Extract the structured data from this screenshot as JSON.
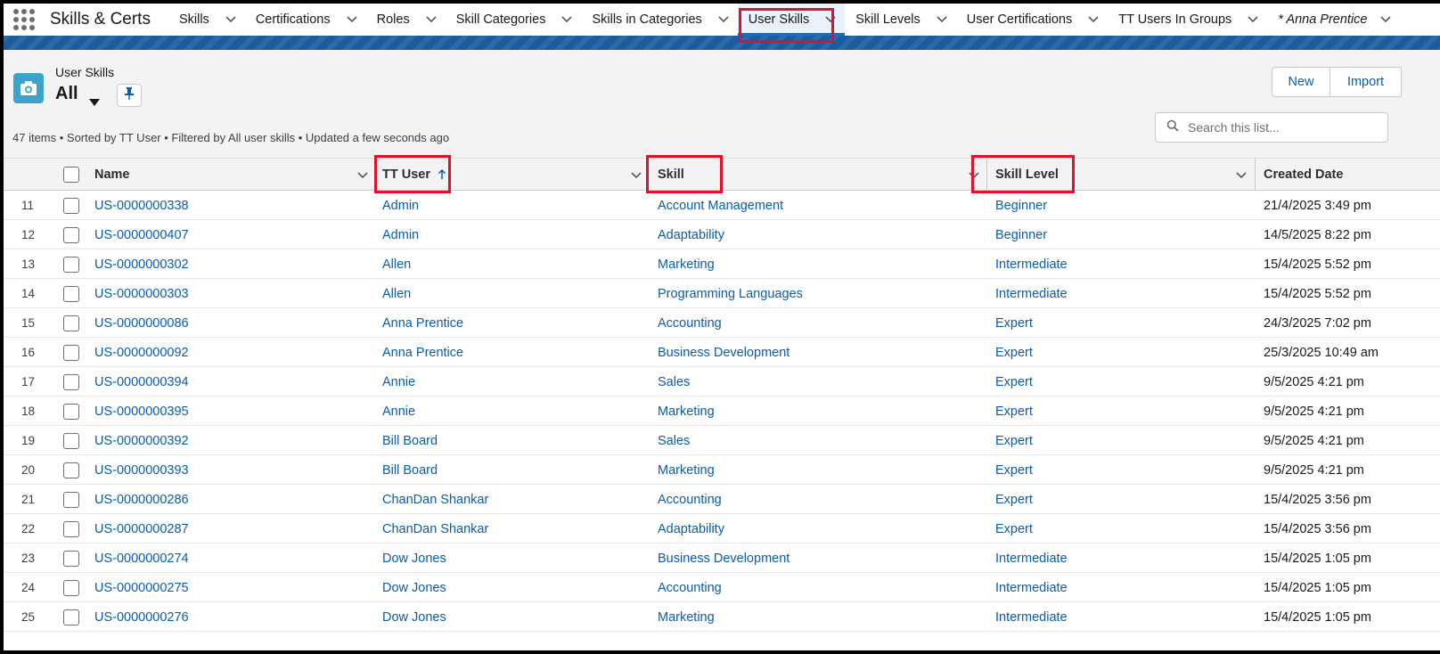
{
  "app": {
    "name": "Skills & Certs"
  },
  "nav": {
    "tabs": [
      {
        "label": "Skills"
      },
      {
        "label": "Certifications"
      },
      {
        "label": "Roles"
      },
      {
        "label": "Skill Categories"
      },
      {
        "label": "Skills in Categories"
      },
      {
        "label": "User Skills",
        "active": true
      },
      {
        "label": "Skill Levels"
      },
      {
        "label": "User Certifications"
      },
      {
        "label": "TT Users In Groups"
      },
      {
        "label": "* Anna Prentice"
      }
    ]
  },
  "list": {
    "object_label": "User Skills",
    "view_name": "All",
    "summary": "47 items • Sorted by TT User • Filtered by All user skills • Updated a few seconds ago",
    "new_label": "New",
    "import_label": "Import",
    "search_placeholder": "Search this list..."
  },
  "columns": {
    "name": "Name",
    "tt_user": "TT User",
    "skill": "Skill",
    "skill_level": "Skill Level",
    "created_date": "Created Date"
  },
  "rows": [
    {
      "num": "11",
      "name": "US-0000000338",
      "tt_user": "Admin",
      "skill": "Account Management",
      "level": "Beginner",
      "created": "21/4/2025 3:49 pm"
    },
    {
      "num": "12",
      "name": "US-0000000407",
      "tt_user": "Admin",
      "skill": "Adaptability",
      "level": "Beginner",
      "created": "14/5/2025 8:22 pm"
    },
    {
      "num": "13",
      "name": "US-0000000302",
      "tt_user": "Allen",
      "skill": "Marketing",
      "level": "Intermediate",
      "created": "15/4/2025 5:52 pm"
    },
    {
      "num": "14",
      "name": "US-0000000303",
      "tt_user": "Allen",
      "skill": "Programming Languages",
      "level": "Intermediate",
      "created": "15/4/2025 5:52 pm"
    },
    {
      "num": "15",
      "name": "US-0000000086",
      "tt_user": "Anna Prentice",
      "skill": "Accounting",
      "level": "Expert",
      "created": "24/3/2025 7:02 pm"
    },
    {
      "num": "16",
      "name": "US-0000000092",
      "tt_user": "Anna Prentice",
      "skill": "Business Development",
      "level": "Expert",
      "created": "25/3/2025 10:49 am"
    },
    {
      "num": "17",
      "name": "US-0000000394",
      "tt_user": "Annie",
      "skill": "Sales",
      "level": "Expert",
      "created": "9/5/2025 4:21 pm"
    },
    {
      "num": "18",
      "name": "US-0000000395",
      "tt_user": "Annie",
      "skill": "Marketing",
      "level": "Expert",
      "created": "9/5/2025 4:21 pm"
    },
    {
      "num": "19",
      "name": "US-0000000392",
      "tt_user": "Bill Board",
      "skill": "Sales",
      "level": "Expert",
      "created": "9/5/2025 4:21 pm"
    },
    {
      "num": "20",
      "name": "US-0000000393",
      "tt_user": "Bill Board",
      "skill": "Marketing",
      "level": "Expert",
      "created": "9/5/2025 4:21 pm"
    },
    {
      "num": "21",
      "name": "US-0000000286",
      "tt_user": "ChanDan Shankar",
      "skill": "Accounting",
      "level": "Expert",
      "created": "15/4/2025 3:56 pm"
    },
    {
      "num": "22",
      "name": "US-0000000287",
      "tt_user": "ChanDan Shankar",
      "skill": "Adaptability",
      "level": "Expert",
      "created": "15/4/2025 3:56 pm"
    },
    {
      "num": "23",
      "name": "US-0000000274",
      "tt_user": "Dow Jones",
      "skill": "Business Development",
      "level": "Intermediate",
      "created": "15/4/2025 1:05 pm"
    },
    {
      "num": "24",
      "name": "US-0000000275",
      "tt_user": "Dow Jones",
      "skill": "Accounting",
      "level": "Intermediate",
      "created": "15/4/2025 1:05 pm"
    },
    {
      "num": "25",
      "name": "US-0000000276",
      "tt_user": "Dow Jones",
      "skill": "Marketing",
      "level": "Intermediate",
      "created": "15/4/2025 1:05 pm"
    }
  ],
  "colors": {
    "brand_band": "#1b5c9e",
    "link": "#0b5cab",
    "highlight": "#e0102a",
    "object_icon": "#3ba3cc"
  },
  "icons": {
    "app_launcher": "waffle-icon",
    "object": "camera-icon",
    "pin": "pin-icon",
    "search": "search-icon",
    "sort": "arrow-up-icon",
    "dropdown": "chevron-down-icon"
  }
}
